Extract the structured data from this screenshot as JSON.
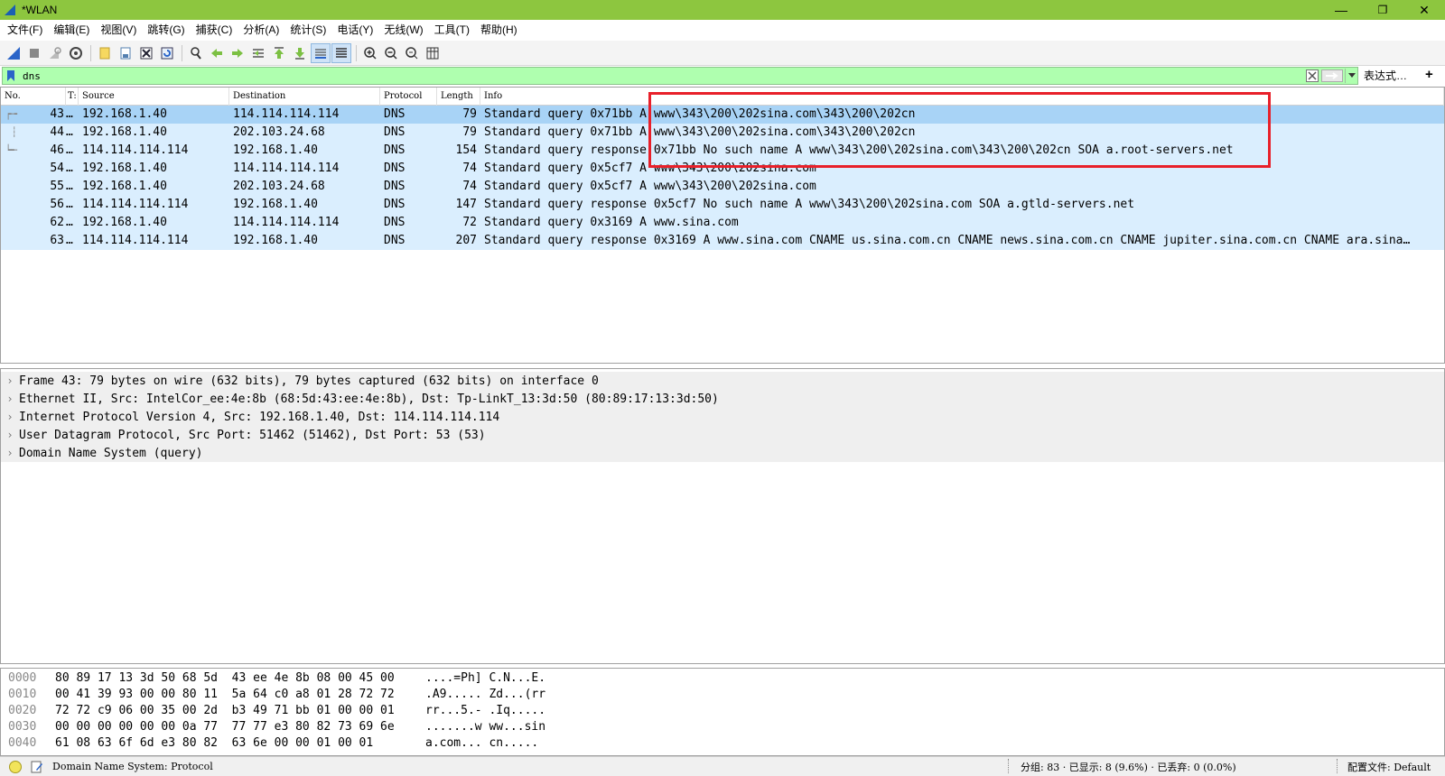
{
  "window": {
    "title": "*WLAN",
    "minimize": "—",
    "maximize": "❐",
    "close": "✕"
  },
  "menu": [
    "文件(F)",
    "编辑(E)",
    "视图(V)",
    "跳转(G)",
    "捕获(C)",
    "分析(A)",
    "统计(S)",
    "电话(Y)",
    "无线(W)",
    "工具(T)",
    "帮助(H)"
  ],
  "toolbar_icons": [
    "start-capture-icon",
    "stop-capture-icon",
    "restart-capture-icon",
    "capture-options-icon",
    "open-file-icon",
    "save-file-icon",
    "close-file-icon",
    "reload-file-icon",
    "find-packet-icon",
    "go-back-icon",
    "go-forward-icon",
    "go-to-packet-icon",
    "go-first-icon",
    "go-last-icon",
    "auto-scroll-icon",
    "colorize-icon",
    "zoom-in-icon",
    "zoom-out-icon",
    "zoom-normal-icon",
    "resize-columns-icon"
  ],
  "filter": {
    "value": "dns",
    "expression_label": "表达式…",
    "add_label": "+"
  },
  "packet_list": {
    "columns": [
      "No.",
      "T:",
      "Source",
      "Destination",
      "Protocol",
      "Length",
      "Info"
    ],
    "rows": [
      {
        "no": "43",
        "t": "…",
        "source": "192.168.1.40",
        "destination": "114.114.114.114",
        "protocol": "DNS",
        "length": "79",
        "info": "Standard query 0x71bb A www\\343\\200\\202sina.com\\343\\200\\202cn"
      },
      {
        "no": "44",
        "t": "…",
        "source": "192.168.1.40",
        "destination": "202.103.24.68",
        "protocol": "DNS",
        "length": "79",
        "info": "Standard query 0x71bb A www\\343\\200\\202sina.com\\343\\200\\202cn"
      },
      {
        "no": "46",
        "t": "…",
        "source": "114.114.114.114",
        "destination": "192.168.1.40",
        "protocol": "DNS",
        "length": "154",
        "info": "Standard query response 0x71bb No such name A www\\343\\200\\202sina.com\\343\\200\\202cn SOA a.root-servers.net"
      },
      {
        "no": "54",
        "t": "…",
        "source": "192.168.1.40",
        "destination": "114.114.114.114",
        "protocol": "DNS",
        "length": "74",
        "info": "Standard query 0x5cf7 A www\\343\\200\\202sina.com"
      },
      {
        "no": "55",
        "t": "…",
        "source": "192.168.1.40",
        "destination": "202.103.24.68",
        "protocol": "DNS",
        "length": "74",
        "info": "Standard query 0x5cf7 A www\\343\\200\\202sina.com"
      },
      {
        "no": "56",
        "t": "…",
        "source": "114.114.114.114",
        "destination": "192.168.1.40",
        "protocol": "DNS",
        "length": "147",
        "info": "Standard query response 0x5cf7 No such name A www\\343\\200\\202sina.com SOA a.gtld-servers.net"
      },
      {
        "no": "62",
        "t": "…",
        "source": "192.168.1.40",
        "destination": "114.114.114.114",
        "protocol": "DNS",
        "length": "72",
        "info": "Standard query 0x3169 A www.sina.com"
      },
      {
        "no": "63",
        "t": "…",
        "source": "114.114.114.114",
        "destination": "192.168.1.40",
        "protocol": "DNS",
        "length": "207",
        "info": "Standard query response 0x3169 A www.sina.com CNAME us.sina.com.cn CNAME news.sina.com.cn CNAME jupiter.sina.com.cn CNAME ara.sina…"
      }
    ]
  },
  "details": [
    "Frame 43: 79 bytes on wire (632 bits), 79 bytes captured (632 bits) on interface 0",
    "Ethernet II, Src: IntelCor_ee:4e:8b (68:5d:43:ee:4e:8b), Dst: Tp-LinkT_13:3d:50 (80:89:17:13:3d:50)",
    "Internet Protocol Version 4, Src: 192.168.1.40, Dst: 114.114.114.114",
    "User Datagram Protocol, Src Port: 51462 (51462), Dst Port: 53 (53)",
    "Domain Name System (query)"
  ],
  "bytes": [
    {
      "offset": "0000",
      "hex": "80 89 17 13 3d 50 68 5d  43 ee 4e 8b 08 00 45 00",
      "ascii": "....=Ph] C.N...E."
    },
    {
      "offset": "0010",
      "hex": "00 41 39 93 00 00 80 11  5a 64 c0 a8 01 28 72 72",
      "ascii": ".A9..... Zd...(rr"
    },
    {
      "offset": "0020",
      "hex": "72 72 c9 06 00 35 00 2d  b3 49 71 bb 01 00 00 01",
      "ascii": "rr...5.- .Iq....."
    },
    {
      "offset": "0030",
      "hex": "00 00 00 00 00 00 0a 77  77 77 e3 80 82 73 69 6e",
      "ascii": ".......w ww...sin"
    },
    {
      "offset": "0040",
      "hex": "61 08 63 6f 6d e3 80 82  63 6e 00 00 01 00 01",
      "ascii": "a.com... cn....."
    }
  ],
  "status": {
    "field_text": "Domain Name System: Protocol",
    "stats": "分组: 83 · 已显示: 8 (9.6%) · 已丢弃: 0 (0.0%)",
    "profile": "配置文件: Default"
  },
  "colors": {
    "titlebar": "#8dc63f",
    "row_bg": "#daeefe",
    "row_selected": "#a8d3f6",
    "filter_bg": "#afffaf",
    "highlight": "#e8202a"
  }
}
